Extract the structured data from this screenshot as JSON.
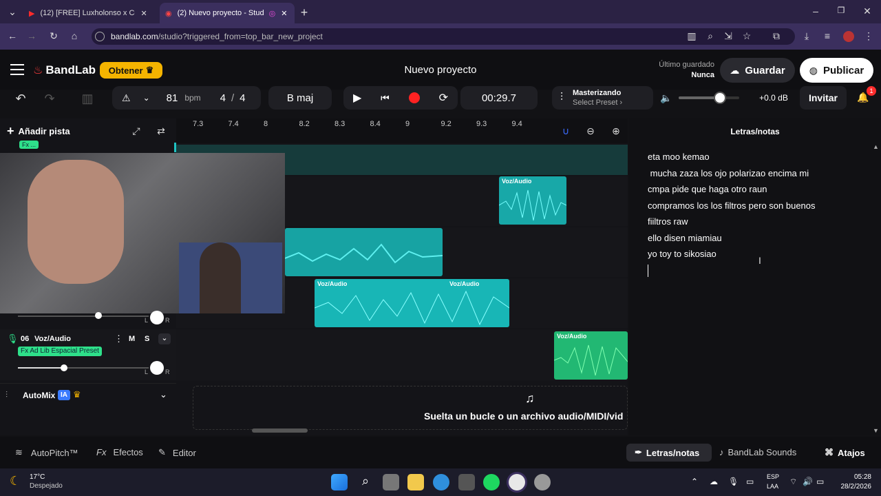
{
  "browser": {
    "tabs": [
      {
        "label": "(12) [FREE] Luxholonso x Cero°"
      },
      {
        "label": "(2) Nuevo proyecto - Studio"
      }
    ],
    "url_domain": "bandlab.com",
    "url_path": "/studio?triggered_from=top_bar_new_project"
  },
  "header": {
    "brand": "BandLab",
    "obtener": "Obtener",
    "project_title": "Nuevo proyecto",
    "last_saved_label": "Último guardado",
    "last_saved_value": "Nunca",
    "save": "Guardar",
    "publish": "Publicar"
  },
  "transport": {
    "bpm": "81",
    "bpm_unit": "bpm",
    "time_sig_num": "4",
    "time_sig_sep": "/",
    "time_sig_den": "4",
    "key": "B maj",
    "time": "00:29.7",
    "mastering_title": "Masterizando",
    "mastering_sub": "Select Preset",
    "db": "+0.0 dB",
    "invite": "Invitar",
    "notif_count": "1",
    "volume_level": 0.68
  },
  "timeline": {
    "add_track": "Añadir pista",
    "ruler": [
      "7.3",
      "7.4",
      "8",
      "8.2",
      "8.3",
      "8.4",
      "9",
      "9.2",
      "9.3",
      "9.4"
    ]
  },
  "tracks": {
    "fx_top": "Fx ...",
    "track6_num": "06",
    "track6_name": "Voz/Audio",
    "track6_m": "M",
    "track6_s": "S",
    "track6_fx": "Fx Ad Lib Espacial Preset",
    "pan_l": "L",
    "pan_r": "R",
    "clip_label": "Voz/Audio",
    "automix": "AutoMix",
    "ia": "IA",
    "drop_text": "Suelta un bucle o un archivo audio/MIDI/vid"
  },
  "lyrics": {
    "title": "Letras/notas",
    "lines": [
      "eta moo kemao",
      " mucha zaza los ojo polarizao encima mi",
      "cmpa pide que haga otro raun",
      "compramos los los filtros pero son buenos",
      "fiiltros raw",
      "ello disen miamiau",
      "yo toy to sikosiao"
    ]
  },
  "bottom": {
    "autopitch": "AutoPitch™",
    "efectos": "Efectos",
    "editor": "Editor",
    "letras": "Letras/notas",
    "sounds": "BandLab Sounds",
    "atajos": "Atajos"
  },
  "taskbar": {
    "temp": "17°C",
    "weather": "Despejado",
    "lang1": "ESP",
    "lang2": "LAA",
    "time": "05:28",
    "date": "28/2/2026"
  },
  "colors": {
    "accent_red": "#ff3d3d",
    "teal": "#1fc2c2",
    "green": "#2ee08a",
    "gold": "#f5b400"
  }
}
